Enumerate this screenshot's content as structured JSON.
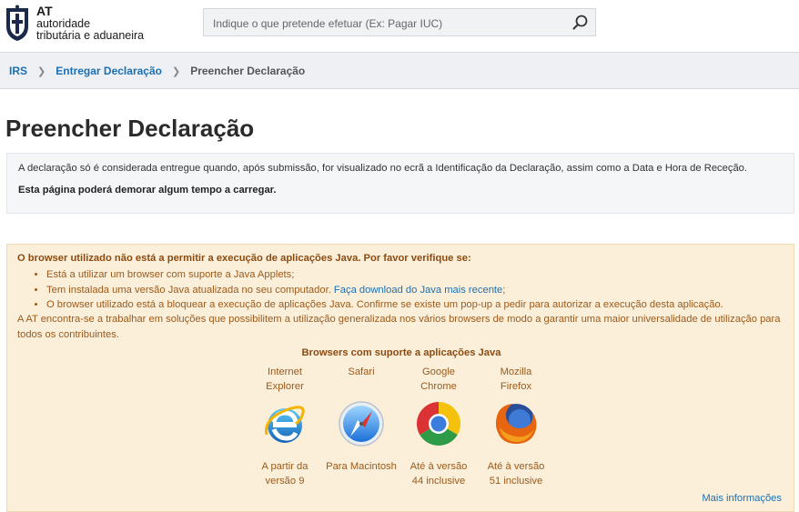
{
  "logo": {
    "line1": "AT",
    "line2": "autoridade",
    "line3": "tributária e aduaneira"
  },
  "search": {
    "placeholder": "Indique o que pretende efetuar (Ex: Pagar IUC)"
  },
  "breadcrumb": {
    "items": [
      "IRS",
      "Entregar Declaração"
    ],
    "current": "Preencher Declaração"
  },
  "page_title": "Preencher Declaração",
  "info": {
    "line1": "A declaração só é considerada entregue quando, após submissão, for visualizado no ecrã a Identificação da Declaração, assim como a Data e Hora de Receção.",
    "line2": "Esta página poderá demorar algum tempo a carregar."
  },
  "warning": {
    "title": "O browser utilizado não está a permitir a execução de aplicações Java. Por favor verifique se:",
    "bullet1": "Está a utilizar um browser com suporte a Java Applets;",
    "bullet2_prefix": "Tem instalada uma versão Java atualizada no seu computador.",
    "bullet2_link": "Faça download do Java mais recente",
    "bullet2_suffix": ";",
    "bullet3": "O browser utilizado está a bloquear a execução de aplicações Java. Confirme se existe um pop-up a pedir para autorizar a execução desta aplicação.",
    "paragraph": "A AT encontra-se a trabalhar em soluções que possibilitem a utilização generalizada nos vários browsers de modo a garantir uma maior universalidade de utilização para todos os contribuintes.",
    "browsers_title": "Browsers com suporte a aplicações Java",
    "more_link": "Mais informações"
  },
  "browsers": [
    {
      "name1": "Internet",
      "name2": "Explorer",
      "note1": "A partir da",
      "note2": "versão 9",
      "icon": "internet-explorer-icon"
    },
    {
      "name1": "Safari",
      "name2": "",
      "note1": "Para Macintosh",
      "note2": "",
      "icon": "safari-icon"
    },
    {
      "name1": "Google",
      "name2": "Chrome",
      "note1": "Até à versão",
      "note2": "44 inclusive",
      "icon": "chrome-icon"
    },
    {
      "name1": "Mozilla",
      "name2": "Firefox",
      "note1": "Até à versão",
      "note2": "51 inclusive",
      "icon": "firefox-icon"
    }
  ],
  "colors": {
    "link": "#1b6fb3",
    "warning_bg": "#fbefd9",
    "warning_text": "#9b5a1c"
  }
}
